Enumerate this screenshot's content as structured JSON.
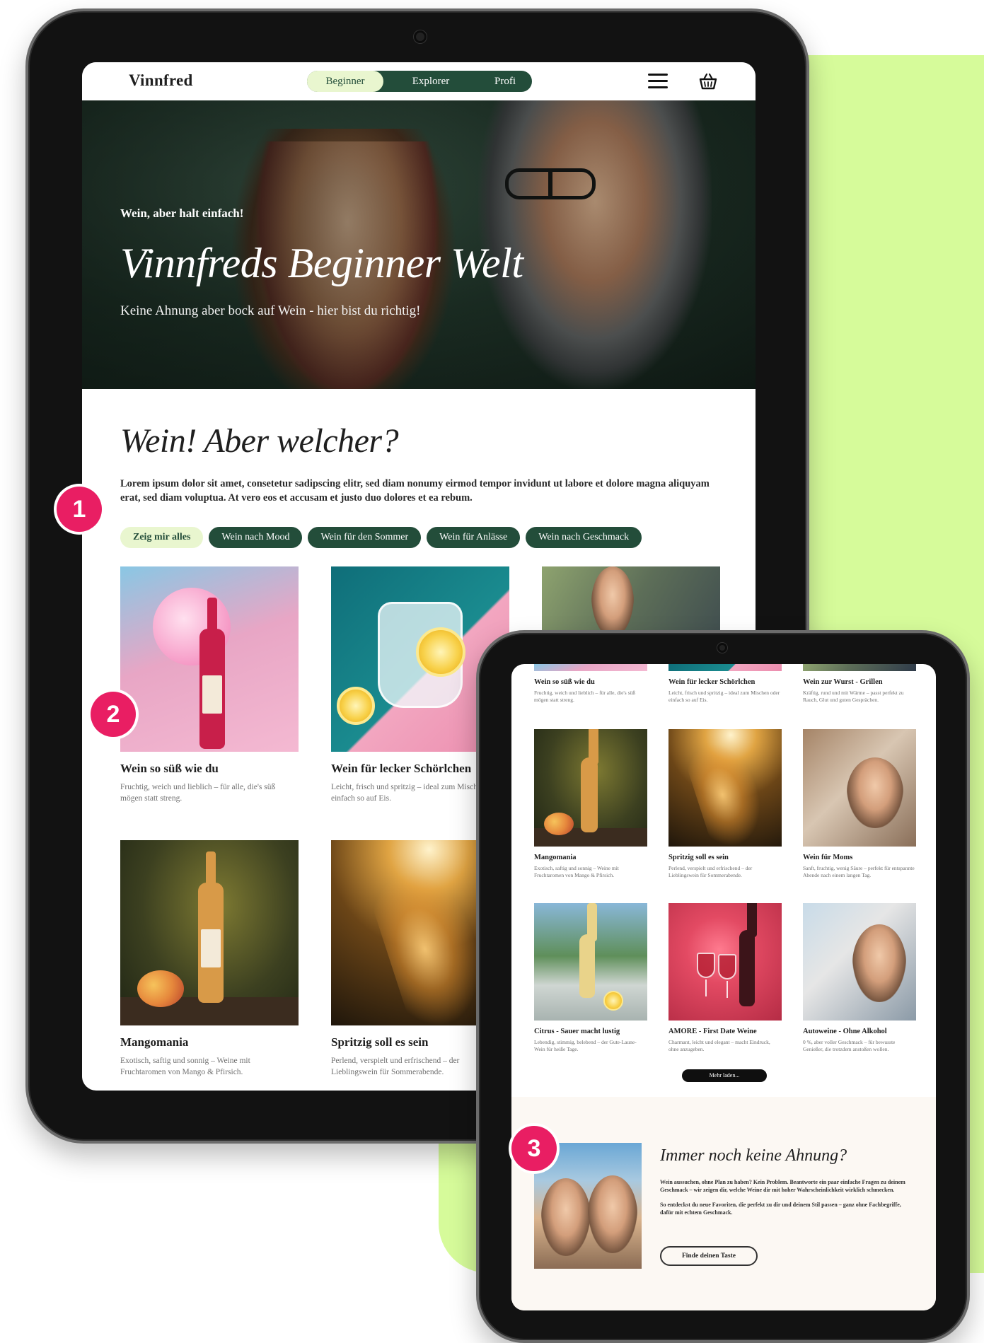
{
  "brand": "Vinnfred",
  "levels": [
    "Beginner",
    "Explorer",
    "Profi"
  ],
  "icons": {
    "menu": "hamburger-menu-icon",
    "cart": "basket-icon"
  },
  "hero": {
    "kicker": "Wein, aber halt einfach!",
    "title": "Vinnfreds Beginner Welt",
    "subtitle": "Keine Ahnung aber bock auf Wein - hier bist du richtig!"
  },
  "intro": {
    "title": "Wein! Aber welcher?",
    "text": "Lorem ipsum dolor sit amet, consetetur sadipscing elitr, sed diam nonumy eirmod tempor invidunt ut labore et dolore magna aliquyam erat, sed diam voluptua. At vero eos et accusam et justo duo dolores et ea rebum."
  },
  "filters": [
    "Zeig mir alles",
    "Wein nach Mood",
    "Wein für den Sommer",
    "Wein für Anlässe",
    "Wein nach Geschmack"
  ],
  "products": [
    {
      "title": "Wein so süß wie du",
      "desc": "Fruchtig, weich und lieblich – für alle, die's süß mögen statt streng."
    },
    {
      "title": "Wein für lecker Schörlchen",
      "desc": "Leicht, frisch und spritzig – ideal zum Mischen oder einfach so auf Eis."
    },
    {
      "title": "Wein zur Wurst - Grillen",
      "desc": "Kräftig, rund und mit Wärme – passt perfekt zu Rauch, Glut und guten Gesprächen."
    },
    {
      "title": "Mangomania",
      "desc": "Exotisch, saftig und sonnig – Weine mit Fruchtaromen von Mango & Pfirsich."
    },
    {
      "title": "Spritzig soll es sein",
      "desc": "Perlend, verspielt und erfrischend – der Lieblingswein für Sommerabende."
    },
    {
      "title": "Wein für Moms",
      "desc": "Sanft, fruchtig, wenig Säure – perfekt für entspannte Abende nach einem langen Tag."
    },
    {
      "title": "Citrus - Sauer macht lustig",
      "desc": "Lebendig, stimmig, belebend – der Gute-Laune-Wein für heiße Tage."
    },
    {
      "title": "AMORE - First Date Weine",
      "desc": "Charmant, leicht und elegant – macht Eindruck, ohne anzugeben."
    },
    {
      "title": "Autoweine - Ohne Alkohol",
      "desc": "0 %, aber voller Geschmack – für bewusste Genießer, die trotzdem anstoßen wollen."
    }
  ],
  "more_button": "Mehr laden...",
  "cta": {
    "title": "Immer noch keine Ahnung?",
    "paragraph1": "Wein aussuchen, ohne Plan zu haben? Kein Problem. Beantworte ein paar einfache Fragen zu deinem Geschmack – wir zeigen dir, welche Weine dir mit hoher Wahrscheinlichkeit wirklich schmecken.",
    "paragraph2": "So entdeckst du neue Favoriten, die perfekt zu dir und deinem Stil passen – ganz ohne Fachbegriffe, dafür mit echtem Geschmack.",
    "button": "Finde deinen Taste"
  },
  "badges": [
    "1",
    "2",
    "3"
  ],
  "colors": {
    "accent_lime": "#d6fb9a",
    "dark_green": "#234d3a",
    "pill_light": "#e9f6cf",
    "badge_pink": "#e91e63"
  }
}
